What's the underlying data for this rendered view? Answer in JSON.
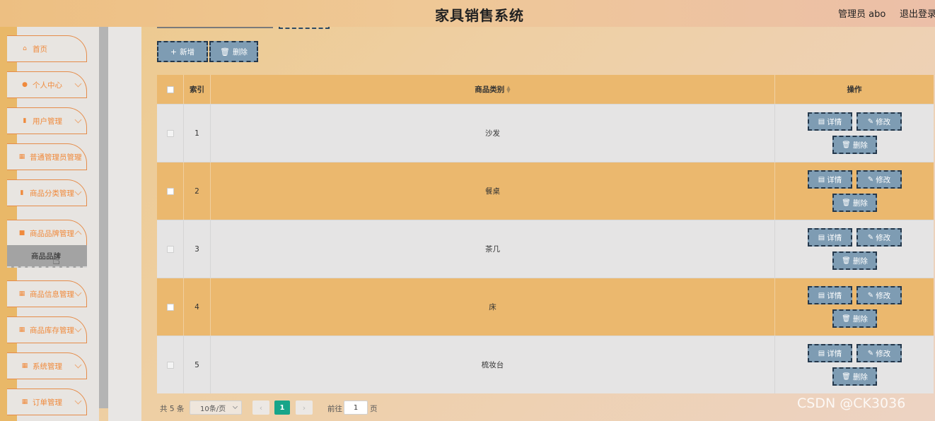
{
  "header": {
    "title": "家具销售系统",
    "user": "管理员 abo",
    "logout": "退出登录"
  },
  "sidebar": {
    "items": [
      {
        "label": "首页",
        "icon": "home-icon",
        "expandable": false
      },
      {
        "label": "个人中心",
        "icon": "user-icon",
        "expandable": true
      },
      {
        "label": "用户管理",
        "icon": "clipboard-icon",
        "expandable": true
      },
      {
        "label": "普通管理员管理",
        "icon": "grid-icon",
        "expandable": true
      },
      {
        "label": "商品分类管理",
        "icon": "clipboard-icon",
        "expandable": true
      },
      {
        "label": "商品品牌管理",
        "icon": "chat-icon",
        "expandable": true
      },
      {
        "label": "商品信息管理",
        "icon": "grid-icon",
        "expandable": true
      },
      {
        "label": "商品库存管理",
        "icon": "grid-icon",
        "expandable": true
      },
      {
        "label": "系统管理",
        "icon": "grid-icon",
        "expandable": true
      },
      {
        "label": "订单管理",
        "icon": "grid-icon",
        "expandable": true
      }
    ],
    "active_sub": "商品品牌"
  },
  "toolbar": {
    "add_label": "新增",
    "delete_label": "删除"
  },
  "table": {
    "columns": {
      "index": "索引",
      "category": "商品类别",
      "actions": "操作"
    },
    "rows": [
      {
        "index": "1",
        "category": "沙发"
      },
      {
        "index": "2",
        "category": "餐桌"
      },
      {
        "index": "3",
        "category": "茶几"
      },
      {
        "index": "4",
        "category": "床"
      },
      {
        "index": "5",
        "category": "梳妆台"
      }
    ],
    "row_actions": {
      "detail": "详情",
      "edit": "修改",
      "delete": "删除"
    }
  },
  "pagination": {
    "total": "共 5 条",
    "page_size": "10条/页",
    "current_page": "1",
    "goto_label": "前往",
    "goto_value": "1",
    "unit": "页"
  },
  "watermark": "CSDN @CK3036",
  "colors": {
    "accent_orange": "#ebb86e",
    "button_blue": "#7e9cb3",
    "pager_active": "#17a589",
    "menu_text": "#f08a3c"
  }
}
